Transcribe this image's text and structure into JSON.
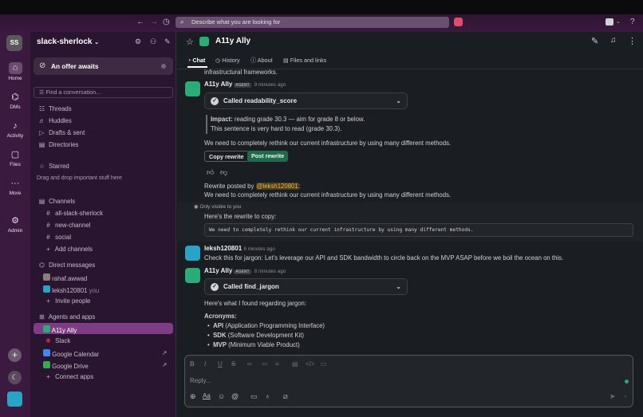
{
  "topbar": {
    "search_placeholder": "Describe what you are looking for"
  },
  "rail": {
    "workspace_initials": "SS",
    "items": [
      {
        "label": "Home",
        "icon": "home-icon"
      },
      {
        "label": "DMs",
        "icon": "dms-icon"
      },
      {
        "label": "Activity",
        "icon": "bell-icon"
      },
      {
        "label": "Files",
        "icon": "files-icon"
      },
      {
        "label": "More",
        "icon": "more-icon"
      },
      {
        "label": "Admin",
        "icon": "gear-icon"
      }
    ]
  },
  "sidebar": {
    "workspace_name": "slack-sherlock",
    "offer": "An offer awaits",
    "find_placeholder": "Find a conversation...",
    "nav": [
      "Threads",
      "Huddles",
      "Drafts & sent",
      "Directories"
    ],
    "starred_header": "Starred",
    "starred_hint": "Drag and drop important stuff here",
    "channels_header": "Channels",
    "channels": [
      "all-slack-sherlock",
      "new-channel",
      "social"
    ],
    "add_channels": "Add channels",
    "dm_header": "Direct messages",
    "dms": [
      "rahaf.awwad",
      "leksh120801"
    ],
    "dm_you": "you",
    "invite": "Invite people",
    "apps_header": "Agents and apps",
    "apps": [
      "A11y Ally",
      "Slack",
      "Google Calendar",
      "Google Drive"
    ],
    "connect_apps": "Connect apps"
  },
  "channel": {
    "title": "A11y Ally",
    "tabs": [
      "Chat",
      "History",
      "About",
      "Files and links"
    ]
  },
  "messages": {
    "truncated_line": "infrastructural frameworks.",
    "msg1": {
      "name": "A11y Ally",
      "badge": "AGENT",
      "time": "9 minutes ago",
      "tool": "Called readability_score",
      "impact_label": "Impact:",
      "impact_text": " reading grade 30.3 — aim for grade 8 or below.",
      "quote2": "This sentence is very hard to read (grade 30.3).",
      "body": "We need to completely rethink our current infrastructure by using many different methods.",
      "btn_copy": "Copy rewrite",
      "btn_post": "Post rewrite",
      "rewrite_by": "Rewrite posted by ",
      "mention": "@leksh120801",
      "colon": ":",
      "rewrite_text": "We need to completely rethink our current infrastructure by using many different methods."
    },
    "ephemeral": {
      "note": "Only visible to you",
      "intro": "Here's the rewrite to copy:",
      "code": "We need to completely rethink our current infrastructure by using many different methods."
    },
    "msg2": {
      "name": "leksh120801",
      "time": "8 minutes ago",
      "body": "Check this for jargon: Let's leverage our API and SDK bandwidth to circle back on the MVP ASAP before we boil the ocean on this."
    },
    "msg3": {
      "name": "A11y Ally",
      "badge": "AGENT",
      "time": "8 minutes ago",
      "tool": "Called find_jargon",
      "intro": "Here's what I found regarding jargon:",
      "acronyms": "Acronyms:",
      "items": [
        {
          "term": "API",
          "def": " (Application Programming Interface)"
        },
        {
          "term": "SDK",
          "def": " (Software Development Kit)"
        },
        {
          "term": "MVP",
          "def": " (Minimum Viable Product)"
        }
      ]
    }
  },
  "composer": {
    "placeholder": "Reply..."
  },
  "colors": {
    "accent": "#2bac76",
    "rail": "#3a1a3f",
    "sidebar": "#2a1530",
    "selected": "#7e3c84"
  }
}
